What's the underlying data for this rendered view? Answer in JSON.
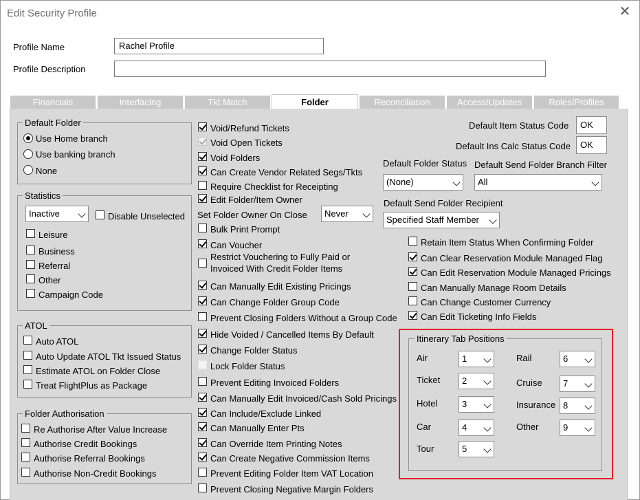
{
  "window": {
    "title": "Edit Security Profile"
  },
  "profile": {
    "name_label": "Profile Name",
    "name_value": "Rachel Profile",
    "desc_label": "Profile Description",
    "desc_value": ""
  },
  "tabs": [
    "Financials",
    "Interfacing",
    "Tkt Match",
    "Folder",
    "Reconciliation",
    "Access/Updates",
    "Roles/Profiles"
  ],
  "default_folder": {
    "title": "Default Folder",
    "options": [
      "Use Home branch",
      "Use banking branch",
      "None"
    ]
  },
  "statistics": {
    "title": "Statistics",
    "select_value": "Inactive",
    "disable_unselected": "Disable Unselected",
    "items": [
      "Leisure",
      "Business",
      "Referral",
      "Other",
      "Campaign Code"
    ]
  },
  "atol": {
    "title": "ATOL",
    "items": [
      "Auto ATOL",
      "Auto Update ATOL Tkt Issued Status",
      "Estimate ATOL on Folder Close",
      "Treat FlightPlus as Package"
    ]
  },
  "folder_auth": {
    "title": "Folder Authorisation",
    "items": [
      "Re Authorise After Value Increase",
      "Authorise Credit Bookings",
      "Authorise Referral Bookings",
      "Authorise Non-Credit Bookings"
    ]
  },
  "middle": {
    "void_refund": "Void/Refund Tickets",
    "void_open": "Void Open Tickets",
    "void_folders": "Void Folders",
    "vendor_segs": "Can Create Vendor Related Segs/Tkts",
    "require_checklist": "Require Checklist for Receipting",
    "edit_owner": "Edit Folder/Item Owner",
    "set_owner_label": "Set Folder Owner On Close",
    "set_owner_value": "Never",
    "bulk_print": "Bulk Print Prompt",
    "can_voucher": "Can Voucher",
    "restrict_line1": "Restrict Vouchering to Fully Paid or",
    "restrict_line2": "Invoiced With Credit Folder Items",
    "edit_pricings": "Can Manually Edit Existing Pricings",
    "change_group": "Can Change Folder Group Code",
    "prevent_group": "Prevent Closing Folders Without a Group Code",
    "hide_voided": "Hide Voided / Cancelled Items By Default",
    "change_status": "Change Folder Status",
    "lock_status": "Lock Folder Status",
    "prevent_invoiced": "Prevent Editing Invoiced Folders",
    "edit_invoiced": "Can Manually Edit Invoiced/Cash Sold Pricings",
    "include_exclude": "Can Include/Exclude Linked",
    "enter_pts": "Can Manually Enter Pts",
    "override_notes": "Can Override Item Printing Notes",
    "negative_commission": "Can Create Negative Commission Items",
    "prevent_vat": "Prevent Editing Folder Item VAT Location",
    "prevent_negative_margin": "Prevent Closing Negative Margin Folders"
  },
  "right": {
    "item_status_label": "Default Item Status Code",
    "item_status_value": "OK",
    "ins_calc_label": "Default Ins Calc Status Code",
    "ins_calc_value": "OK",
    "folder_status_label": "Default Folder Status",
    "folder_status_value": "(None)",
    "branch_filter_label": "Default Send Folder Branch Filter",
    "branch_filter_value": "All",
    "recipient_label": "Default Send Folder Recipient",
    "recipient_value": "Specified Staff Member",
    "retain_status": "Retain Item Status When Confirming Folder",
    "clear_flag": "Can Clear Reservation Module Managed Flag",
    "edit_reservation": "Can Edit Reservation Module Managed Pricings",
    "room_details": "Can Manually Manage Room Details",
    "customer_currency": "Can Change Customer Currency",
    "ticketing_info": "Can Edit Ticketing Info Fields"
  },
  "itinerary": {
    "title": "Itinerary Tab Positions",
    "air_label": "Air",
    "air_value": "1",
    "ticket_label": "Ticket",
    "ticket_value": "2",
    "hotel_label": "Hotel",
    "hotel_value": "3",
    "car_label": "Car",
    "car_value": "4",
    "tour_label": "Tour",
    "tour_value": "5",
    "rail_label": "Rail",
    "rail_value": "6",
    "cruise_label": "Cruise",
    "cruise_value": "7",
    "insurance_label": "Insurance",
    "insurance_value": "8",
    "other_label": "Other",
    "other_value": "9"
  }
}
